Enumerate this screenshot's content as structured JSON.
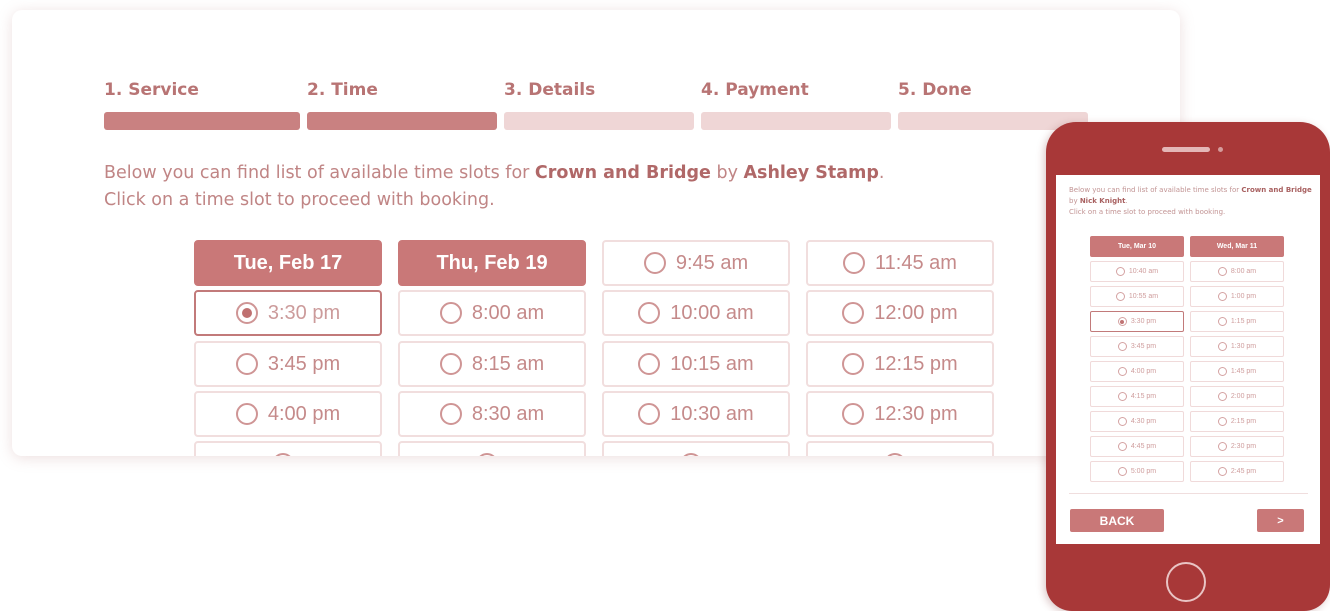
{
  "steps": [
    {
      "label": "1. Service",
      "state": "complete"
    },
    {
      "label": "2. Time",
      "state": "complete"
    },
    {
      "label": "3. Details",
      "state": "pending"
    },
    {
      "label": "4. Payment",
      "state": "pending"
    },
    {
      "label": "5. Done",
      "state": "pending"
    }
  ],
  "intro": {
    "line1_prefix": "Below you can find list of available time slots for ",
    "service": "Crown and Bridge",
    "by": " by ",
    "staff": "Ashley Stamp",
    "period": ".",
    "line2": "Click on a time slot to proceed with booking."
  },
  "slots": {
    "col1": {
      "header": "Tue, Feb 17",
      "times": [
        "3:30 pm",
        "3:45 pm",
        "4:00 pm"
      ],
      "selected": "3:30 pm"
    },
    "col2": {
      "header": "Thu, Feb 19",
      "times": [
        "8:00 am",
        "8:15 am",
        "8:30 am"
      ]
    },
    "col3": {
      "times": [
        "9:45 am",
        "10:00 am",
        "10:15 am",
        "10:30 am"
      ]
    },
    "col4": {
      "times": [
        "11:45 am",
        "12:00 pm",
        "12:15 pm",
        "12:30 pm"
      ]
    }
  },
  "mobile": {
    "intro_prefix": "Below you can find list of available time slots for ",
    "service": "Crown and Bridge",
    "by": " by ",
    "staff": "Nick Knight",
    "period": ".",
    "line2": "Click on a time slot to proceed with booking.",
    "col1": {
      "header": "Tue, Mar 10",
      "times": [
        "10:40 am",
        "10:55 am",
        "3:30 pm",
        "3:45 pm",
        "4:00 pm",
        "4:15 pm",
        "4:30 pm",
        "4:45 pm",
        "5:00 pm"
      ],
      "selected": "3:30 pm"
    },
    "col2": {
      "header": "Wed, Mar 11",
      "times": [
        "8:00 am",
        "1:00 pm",
        "1:15 pm",
        "1:30 pm",
        "1:45 pm",
        "2:00 pm",
        "2:15 pm",
        "2:30 pm",
        "2:45 pm"
      ]
    },
    "back_label": "BACK",
    "next_label": ">"
  },
  "colors": {
    "accent": "#c97878",
    "accent_light": "#efd6d6",
    "phone_body": "#a83838"
  }
}
